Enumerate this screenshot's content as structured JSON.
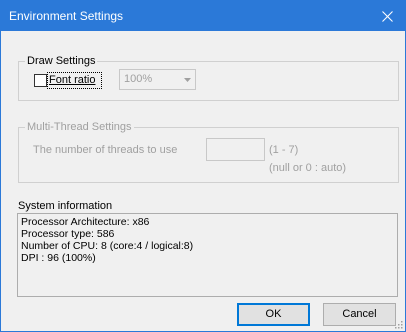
{
  "window": {
    "title": "Environment Settings"
  },
  "draw_settings": {
    "legend": "Draw Settings",
    "font_ratio_label": "Font ratio",
    "font_ratio_checked": false,
    "font_ratio_value": "100%"
  },
  "multi_thread": {
    "legend": "Multi-Thread Settings",
    "threads_label": "The number of threads to use",
    "threads_value": "",
    "range_hint": "(1 - 7)",
    "auto_hint": "(null or 0 : auto)"
  },
  "system_info": {
    "label": "System information",
    "lines": [
      "Processor Architecture:  x86",
      "Processor type:  586",
      "Number of CPU:  8 (core:4 / logical:8)",
      "DPI : 96 (100%)"
    ]
  },
  "buttons": {
    "ok": "OK",
    "cancel": "Cancel"
  },
  "colors": {
    "titlebar": "#2b79d8",
    "dialog_bg": "#f0f0f0",
    "disabled_text": "#a0a0a0"
  }
}
